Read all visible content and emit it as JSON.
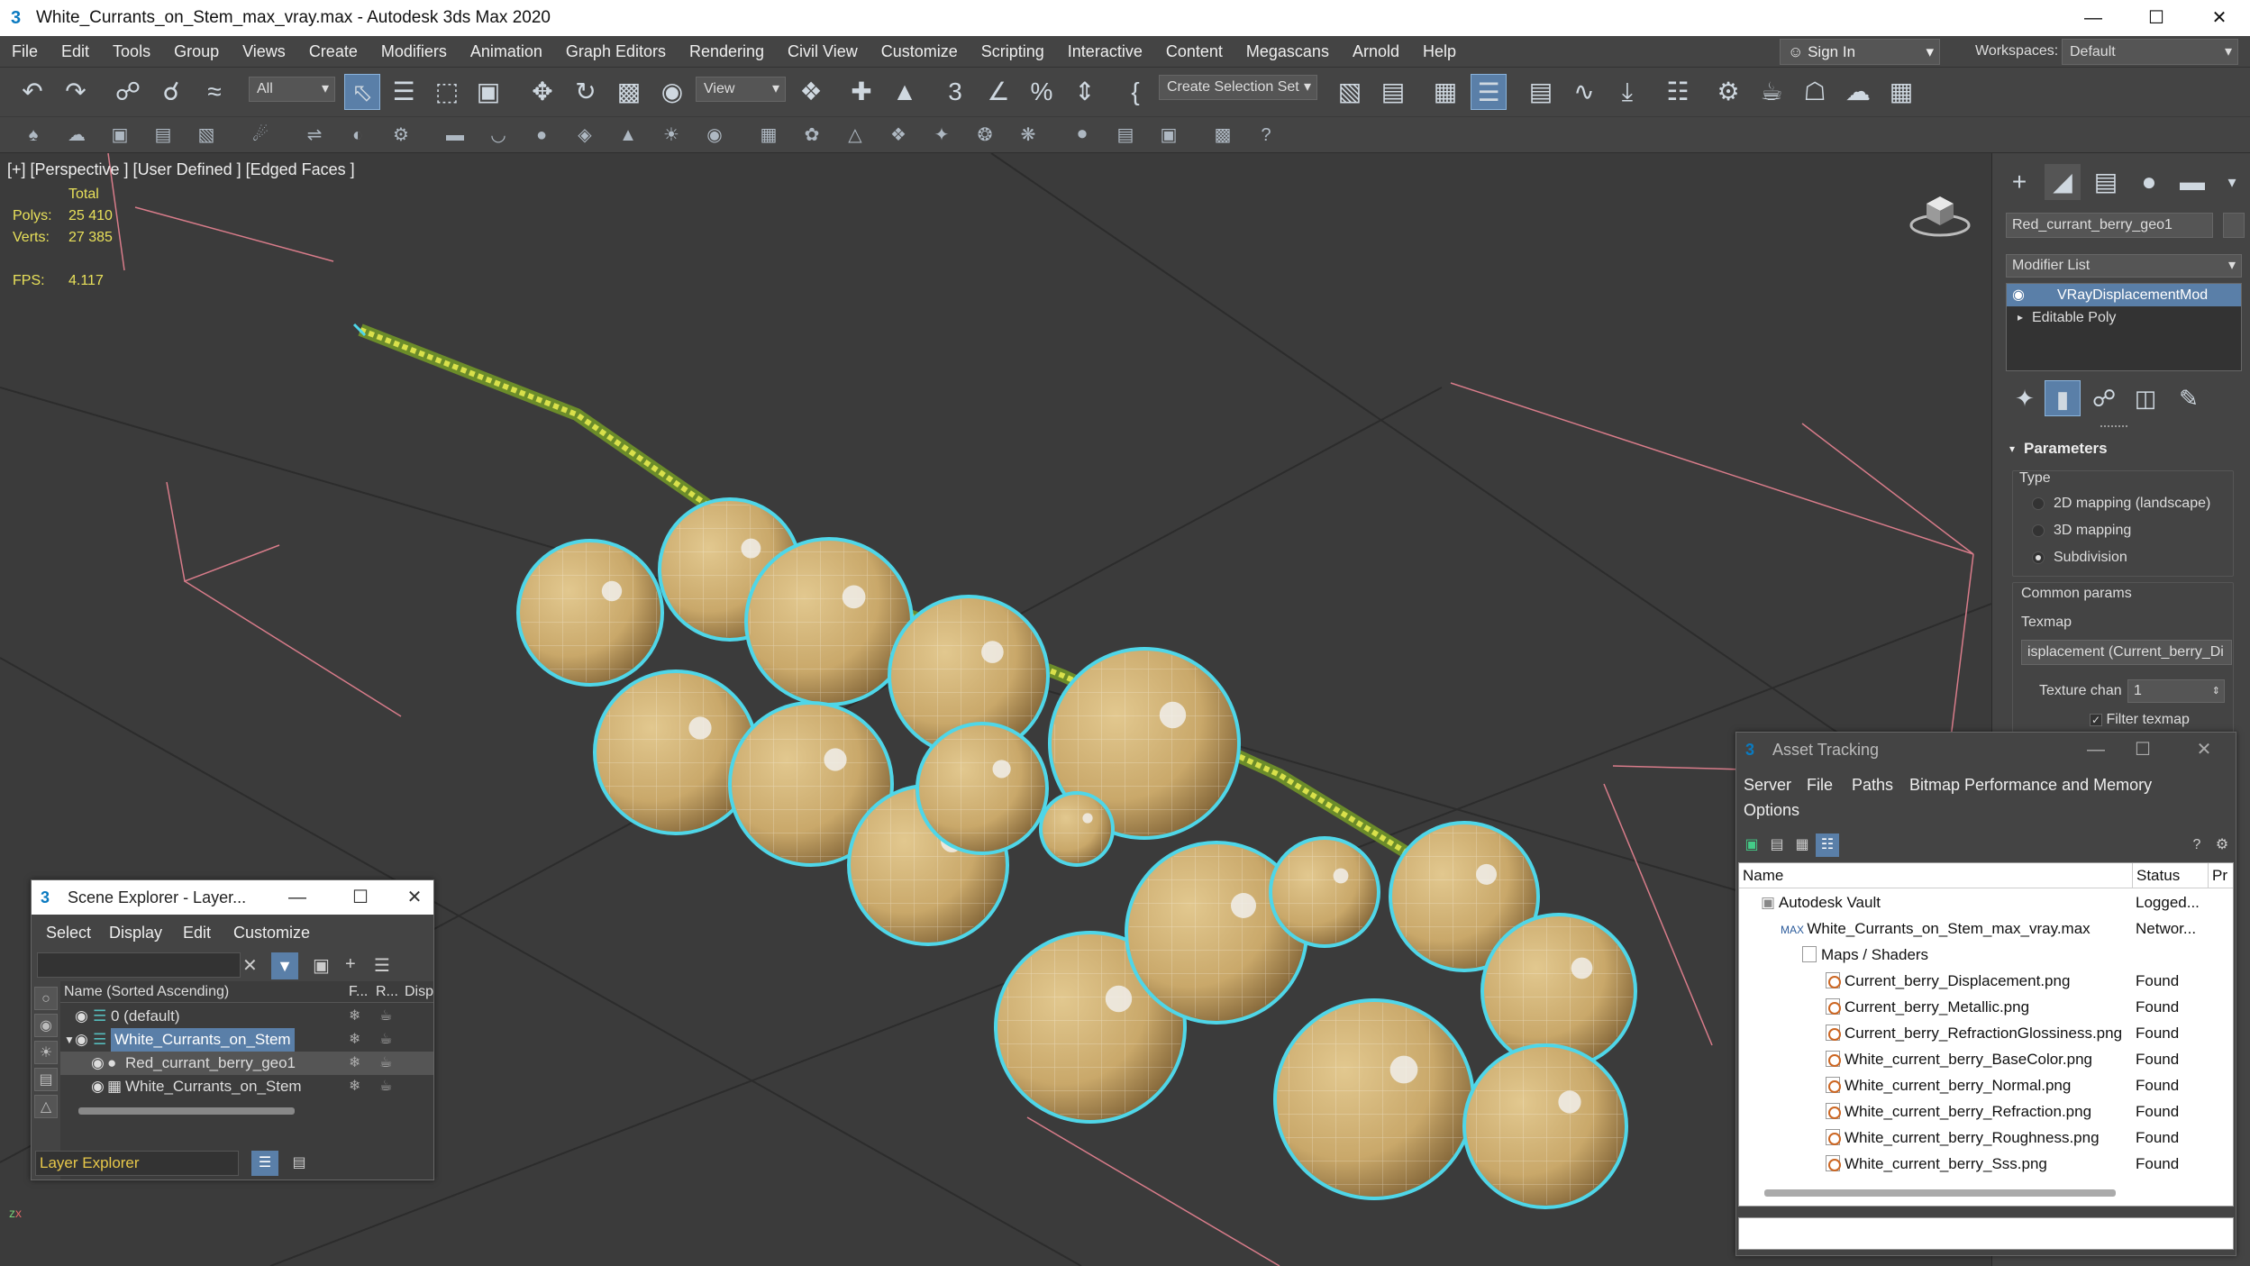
{
  "window": {
    "title": "White_Currants_on_Stem_max_vray.max - Autodesk 3ds Max 2020",
    "app_icon": "3"
  },
  "menu": [
    "File",
    "Edit",
    "Tools",
    "Group",
    "Views",
    "Create",
    "Modifiers",
    "Animation",
    "Graph Editors",
    "Rendering",
    "Civil View",
    "Customize",
    "Scripting",
    "Interactive",
    "Content",
    "Megascans",
    "Arnold",
    "Help"
  ],
  "signin": "Sign In",
  "workspaces": {
    "label": "Workspaces:",
    "value": "Default"
  },
  "toolbar": {
    "filter_value": "All",
    "ref_coord": "View",
    "selection_set": "Create Selection Set"
  },
  "viewport": {
    "label": "[+] [Perspective ] [User Defined ] [Edged Faces ]",
    "stats": {
      "total_label": "Total",
      "polys_label": "Polys:",
      "polys_value": "25 410",
      "verts_label": "Verts:",
      "verts_value": "27 385",
      "fps_label": "FPS:",
      "fps_value": "4.117"
    }
  },
  "command_panel": {
    "object_name": "Red_currant_berry_geo1",
    "modifier_list": "Modifier List",
    "stack": [
      "VRayDisplacementMod",
      "Editable Poly"
    ],
    "parameters": "Parameters",
    "type_label": "Type",
    "type_options": [
      "2D mapping (landscape)",
      "3D mapping",
      "Subdivision"
    ],
    "type_selected": 2,
    "common_params": "Common params",
    "texmap_label": "Texmap",
    "texmap_value": "isplacement (Current_berry_Di",
    "texture_chan_label": "Texture chan",
    "texture_chan_value": "1",
    "filter_texmap": "Filter texmap"
  },
  "scene_explorer": {
    "title": "Scene Explorer - Layer...",
    "menu": [
      "Select",
      "Display",
      "Edit",
      "Customize"
    ],
    "columns": {
      "name": "Name (Sorted Ascending)",
      "frozen": "F...",
      "render": "R...",
      "display": "Disp"
    },
    "rows": [
      {
        "name": "0 (default)"
      },
      {
        "name": "White_Currants_on_Stem"
      },
      {
        "name": "Red_currant_berry_geo1"
      },
      {
        "name": "White_Currants_on_Stem"
      }
    ],
    "footer": "Layer Explorer"
  },
  "asset_tracking": {
    "title": "Asset Tracking",
    "menu": [
      "Server",
      "File",
      "Paths",
      "Bitmap Performance and Memory",
      "Options"
    ],
    "columns": {
      "name": "Name",
      "status": "Status",
      "extra": "Pr"
    },
    "rows": [
      {
        "name": "Autodesk Vault",
        "status": "Logged..."
      },
      {
        "name": "White_Currants_on_Stem_max_vray.max",
        "status": "Networ..."
      },
      {
        "name": "Maps / Shaders",
        "status": ""
      },
      {
        "name": "Current_berry_Displacement.png",
        "status": "Found"
      },
      {
        "name": "Current_berry_Metallic.png",
        "status": "Found"
      },
      {
        "name": "Current_berry_RefractionGlossiness.png",
        "status": "Found"
      },
      {
        "name": "White_current_berry_BaseColor.png",
        "status": "Found"
      },
      {
        "name": "White_current_berry_Normal.png",
        "status": "Found"
      },
      {
        "name": "White_current_berry_Refraction.png",
        "status": "Found"
      },
      {
        "name": "White_current_berry_Roughness.png",
        "status": "Found"
      },
      {
        "name": "White_current_berry_Sss.png",
        "status": "Found"
      }
    ]
  },
  "colors": {
    "selection_outline": "#4fd6e8",
    "berry_fill": "#c9a86a",
    "accent_blue": "#5a7fa8",
    "stats_yellow": "#e8e05a"
  }
}
